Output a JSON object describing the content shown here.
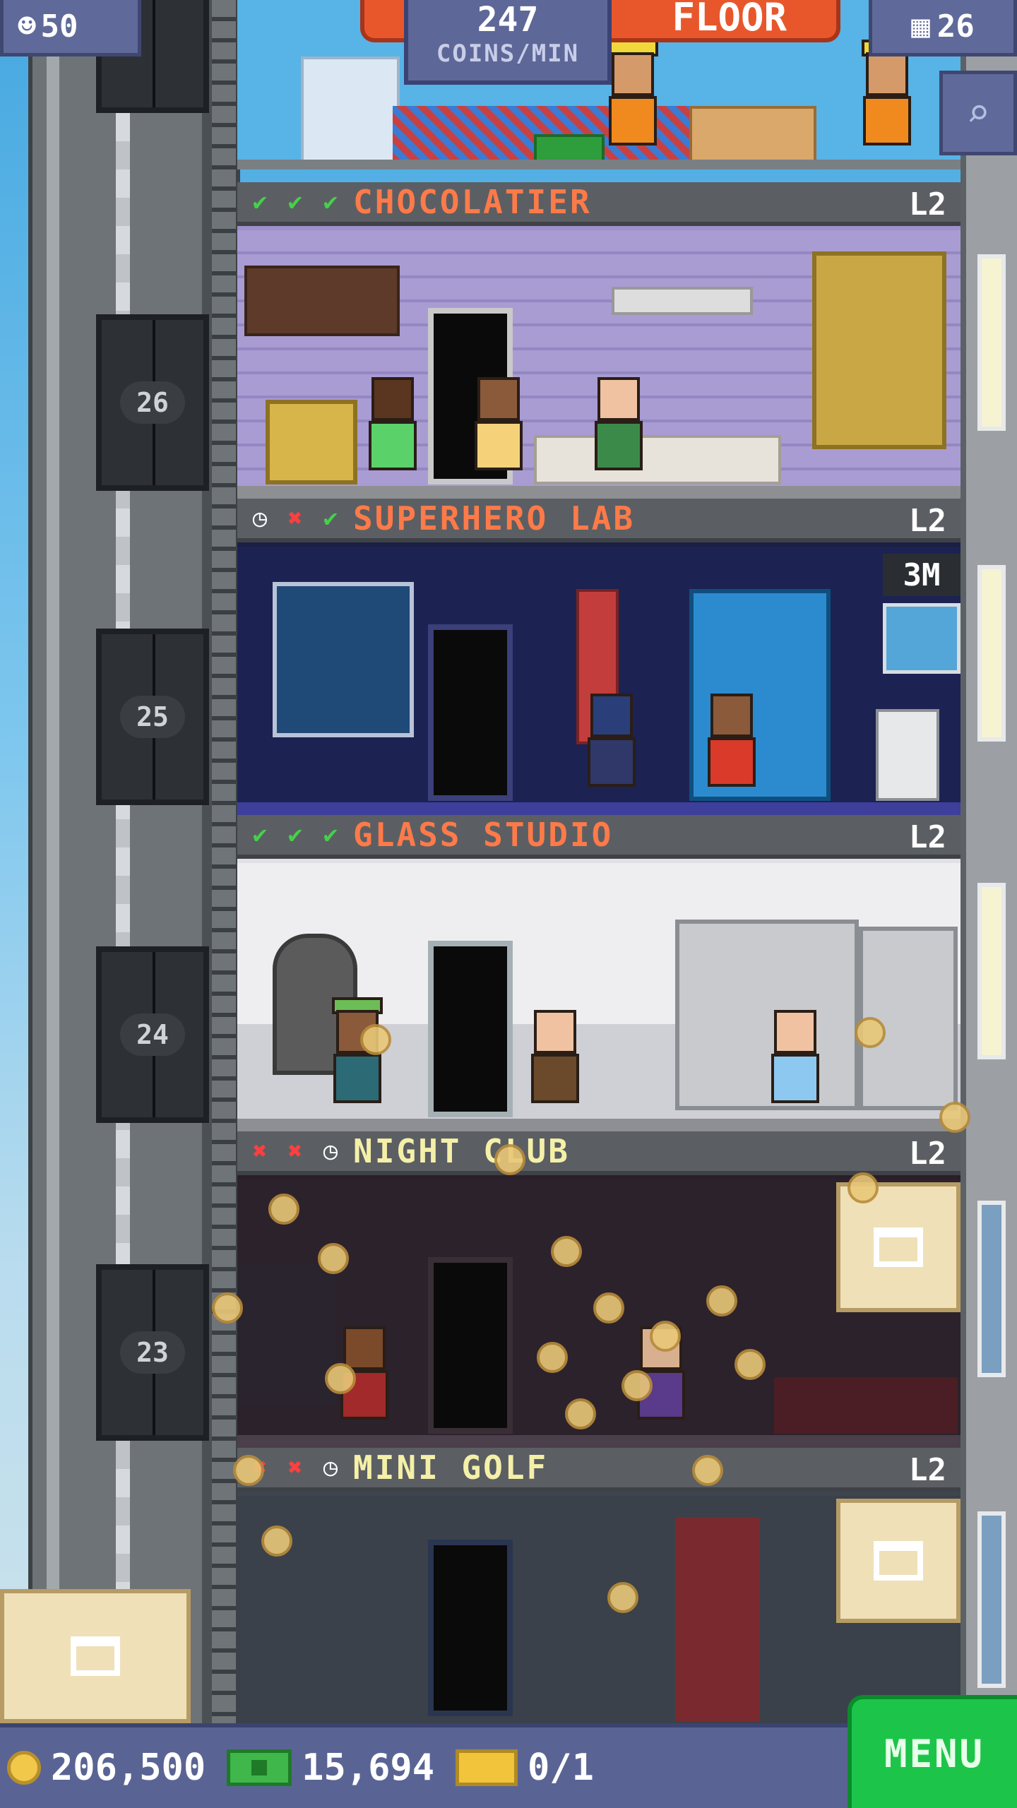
{
  "hud": {
    "population": "50",
    "coins_per_min_value": "247",
    "coins_per_min_label": "COINS/MIN",
    "build_label": "FLOOR",
    "floor_count": "26"
  },
  "floors": [
    {
      "name": "CHOCOLATIER",
      "level": "L2",
      "status": [
        "check",
        "check",
        "check"
      ],
      "floor_number": "26",
      "banner": ""
    },
    {
      "name": "SUPERHERO LAB",
      "level": "L2",
      "status": [
        "clock",
        "cross",
        "check"
      ],
      "floor_number": "25",
      "banner": "3M"
    },
    {
      "name": "GLASS STUDIO",
      "level": "L2",
      "status": [
        "check",
        "check",
        "check"
      ],
      "floor_number": "24",
      "banner": ""
    },
    {
      "name": "NIGHT CLUB",
      "level": "L2",
      "status": [
        "cross",
        "cross",
        "clock"
      ],
      "floor_number": "23",
      "banner": ""
    },
    {
      "name": "MINI GOLF",
      "level": "L2",
      "status": [
        "cross",
        "cross",
        "clock"
      ],
      "floor_number": "",
      "banner": ""
    }
  ],
  "bottom": {
    "coins": "206,500",
    "bux": "15,694",
    "tickets": "0/1",
    "menu_label": "MENU"
  },
  "colors": {
    "floor_name_orange": "#ff7a49",
    "floor_name_yellow": "#f5f0a8",
    "check": "#46d04a",
    "cross": "#ff3f3f",
    "hud_blue": "#5f6a9a",
    "menu_green": "#1cc54a"
  }
}
